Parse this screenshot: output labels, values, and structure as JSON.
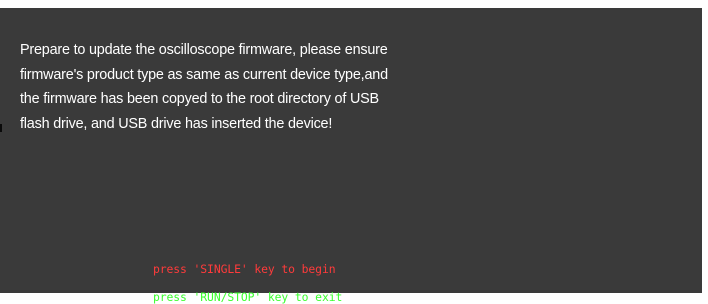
{
  "colors": {
    "background": "#3a3a3a",
    "message_text": "#ffffff",
    "begin_hint": "#ff3b3b",
    "exit_hint": "#3bff2f"
  },
  "dialog": {
    "message_lines": [
      "Prepare to update the oscilloscope firmware, please ensure",
      "firmware's product type as same as current device type,and",
      "the firmware has been copyed to the root directory of USB",
      "flash drive, and USB drive has inserted the device!"
    ],
    "begin_hint": "press 'SINGLE' key to begin",
    "exit_hint": "press 'RUN/STOP' key to exit"
  }
}
